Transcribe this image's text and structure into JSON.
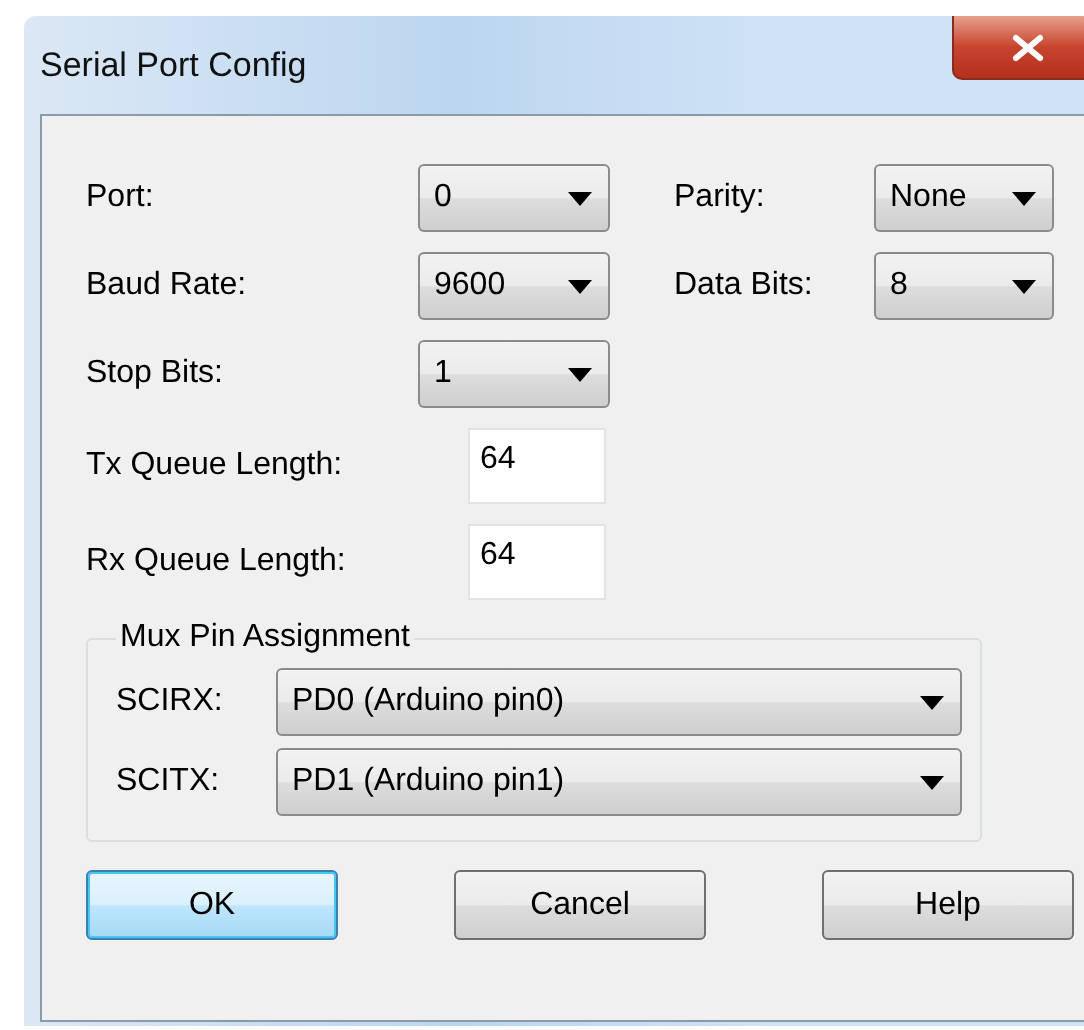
{
  "window": {
    "title": "Serial Port Config"
  },
  "rows": [
    [
      {
        "label": "Port:",
        "kind": "dropdown",
        "value": "0"
      },
      {
        "label": "Parity:",
        "kind": "dropdown",
        "value": "None"
      }
    ],
    [
      {
        "label": "Baud Rate:",
        "kind": "dropdown",
        "value": "9600"
      },
      {
        "label": "Data Bits:",
        "kind": "dropdown",
        "value": "8"
      }
    ],
    [
      {
        "label": "Stop Bits:",
        "kind": "dropdown",
        "value": "1"
      }
    ],
    [
      {
        "label": "Tx Queue Length:",
        "kind": "textbox",
        "value": "64"
      }
    ],
    [
      {
        "label": "Rx Queue Length:",
        "kind": "textbox",
        "value": "64"
      }
    ]
  ],
  "group": {
    "legend": "Mux Pin Assignment",
    "fields": [
      {
        "label": "SCIRX:",
        "value": "PD0 (Arduino pin0)"
      },
      {
        "label": "SCITX:",
        "value": "PD1 (Arduino pin1)"
      }
    ]
  },
  "buttons": [
    {
      "label": "OK",
      "default": true
    },
    {
      "label": "Cancel",
      "default": false
    },
    {
      "label": "Help",
      "default": false
    }
  ]
}
